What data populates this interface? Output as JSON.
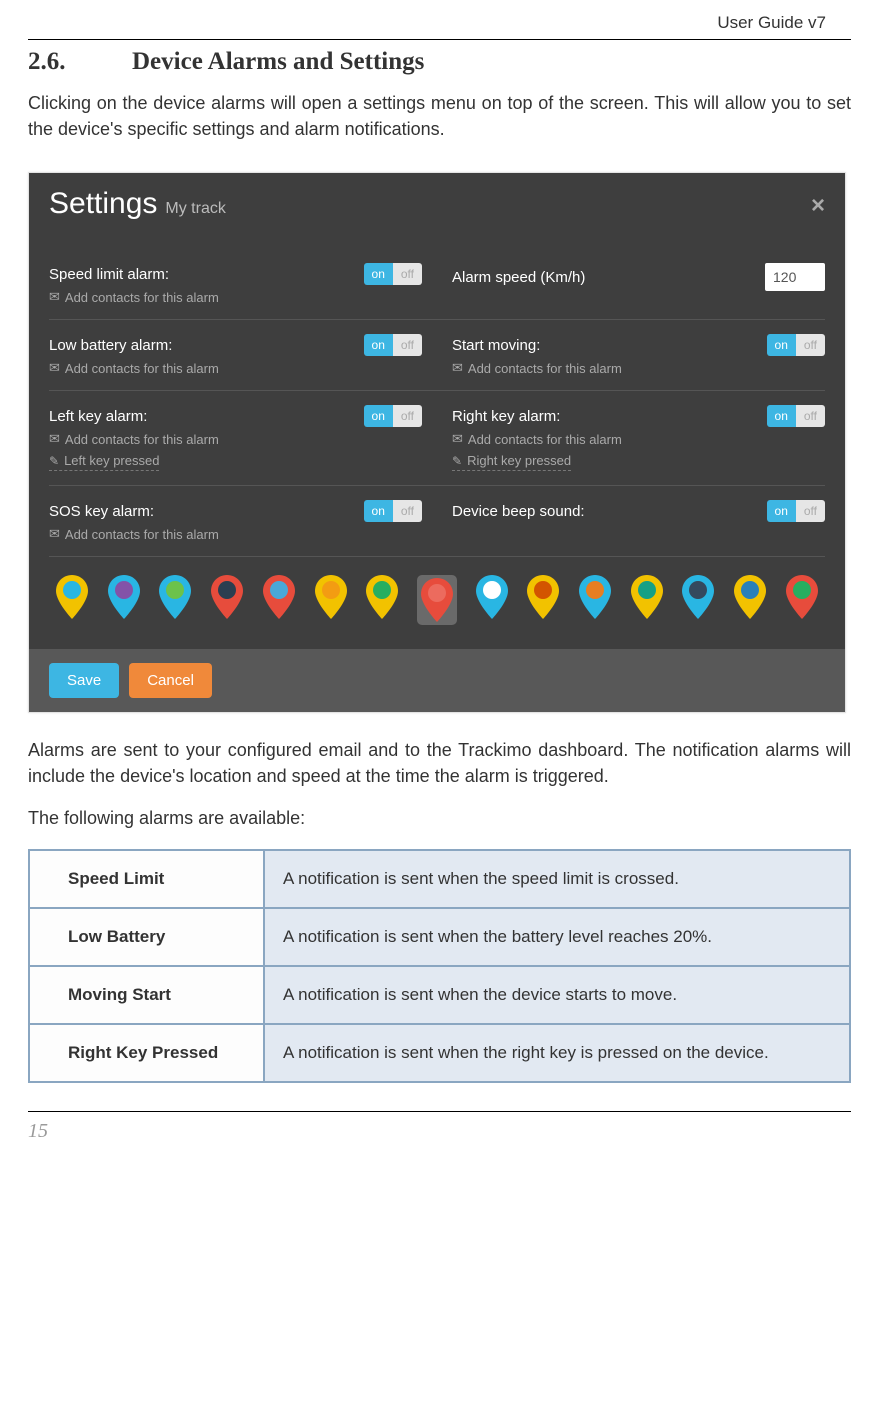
{
  "header": {
    "doc_title": "User Guide v7"
  },
  "section": {
    "number": "2.6.",
    "title": "Device Alarms and Settings",
    "intro": "Clicking on the device alarms will open a settings menu on top of the screen. This will allow you to set the device's specific settings and alarm notifications.",
    "after_panel": "Alarms are sent to your configured email and to the Trackimo dashboard. The notification alarms will include the device's location and speed at the time the alarm is triggered.",
    "list_intro": "The following alarms are available:"
  },
  "settings": {
    "title": "Settings",
    "subtitle": "My track",
    "close": "×",
    "toggle_on": "on",
    "toggle_off": "off",
    "add_contacts": "Add contacts for this alarm",
    "rows": [
      {
        "left": {
          "label": "Speed limit alarm:",
          "toggle": true,
          "contacts": true
        },
        "right": {
          "label": "Alarm speed (Km/h)",
          "input_value": "120"
        }
      },
      {
        "left": {
          "label": "Low battery alarm:",
          "toggle": true,
          "contacts": true
        },
        "right": {
          "label": "Start moving:",
          "toggle": true,
          "contacts": true
        }
      },
      {
        "left": {
          "label": "Left key alarm:",
          "toggle": true,
          "contacts": true,
          "key_text": "Left key pressed"
        },
        "right": {
          "label": "Right key alarm:",
          "toggle": true,
          "contacts": true,
          "key_text": "Right key pressed"
        }
      },
      {
        "left": {
          "label": "SOS key alarm:",
          "toggle": true,
          "contacts": true
        },
        "right": {
          "label": "Device beep sound:",
          "toggle": true
        }
      }
    ],
    "pins": [
      {
        "fill": "#f2c200",
        "inner": "#29b6e3"
      },
      {
        "fill": "#29b6e3",
        "inner": "#8353a8"
      },
      {
        "fill": "#29b6e3",
        "inner": "#6cc24a"
      },
      {
        "fill": "#e74c3c",
        "inner": "#2c3e50"
      },
      {
        "fill": "#e74c3c",
        "inner": "#4aa8d8"
      },
      {
        "fill": "#f2c200",
        "inner": "#f39c12"
      },
      {
        "fill": "#f2c200",
        "inner": "#27ae60"
      },
      {
        "fill": "#e74c3c",
        "inner": "#ec6b5e",
        "selected": true
      },
      {
        "fill": "#29b6e3",
        "inner": "#ffffff"
      },
      {
        "fill": "#f2c200",
        "inner": "#d35400"
      },
      {
        "fill": "#29b6e3",
        "inner": "#e67e22"
      },
      {
        "fill": "#f2c200",
        "inner": "#16a085"
      },
      {
        "fill": "#29b6e3",
        "inner": "#34495e"
      },
      {
        "fill": "#f2c200",
        "inner": "#2980b9"
      },
      {
        "fill": "#e74c3c",
        "inner": "#27ae60"
      }
    ],
    "save": "Save",
    "cancel": "Cancel"
  },
  "alarm_table": [
    {
      "name": "Speed Limit",
      "desc": "A notification is sent when the speed limit is crossed."
    },
    {
      "name": "Low Battery",
      "desc": "A notification is sent when the battery level reaches 20%."
    },
    {
      "name": "Moving Start",
      "desc": "A notification is sent when the device starts to move."
    },
    {
      "name": "Right Key Pressed",
      "desc": "A notification is sent when the right key is pressed on the device."
    }
  ],
  "page_number": "15"
}
